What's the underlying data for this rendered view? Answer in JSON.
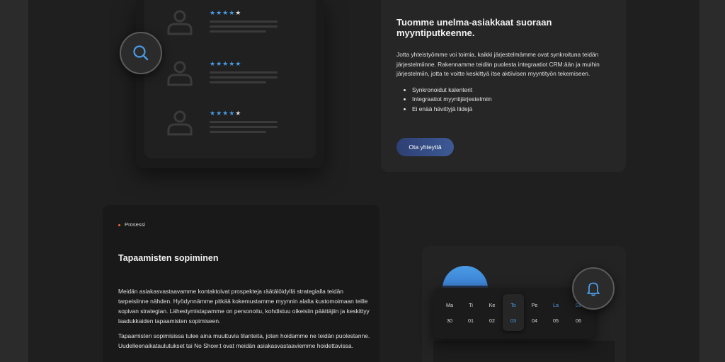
{
  "reviews": {
    "items": [
      {
        "stars_on": "★★★★",
        "stars_off": "★"
      },
      {
        "stars_on": "★★★★★",
        "stars_off": ""
      },
      {
        "stars_on": "★★★★",
        "stars_off": "★"
      }
    ]
  },
  "crm": {
    "title": "Tuomme unelma-asiakkaat suoraan myyntiputkeenne.",
    "body": "Jotta yhteistyömme voi toimia, kaikki järjestelmämme ovat synkroituna teidän järjestelmiinne. Rakennamme teidän puolesta integraatiot CRM:ään ja muihin järjestelmiin, jotta te voitte keskittyä itse aktiivisen myyntityön tekemiseen.",
    "bullets": [
      "Synkronoidut kalenterit",
      "Integraatiot myyntijärjestelmiin",
      "Ei enää hävittyjä liidejä"
    ],
    "button": "Ota yhteyttä"
  },
  "process": {
    "tag": "Prosessi",
    "title": "Tapaamisten sopiminen",
    "p1": "Meidän asiakasvastaavamme kontaktoivat prospekteja räätälöidyllä strategialla teidän tarpeisiinne nähden. Hyödynnämme pitkää kokemustamme myynnin alalta kustomoimaan teille sopivan strategian. Lähestymistapamme on personoitu, kohdistuu oikeisiin päättäjiin ja keskittyy laadukkaiden tapaamisten sopimiseen.",
    "p2": "Tapaamisten sopimisissa tulee aina muuttuvia tilanteita, joten hoidamme ne teidän puolestanne. Uudelleenaikataulutukset tai No Show:t ovat meidän asiakasvastaaviemme hoidettavissa."
  },
  "calendar": {
    "days": [
      "Ma",
      "Ti",
      "Ke",
      "To",
      "Pe",
      "La",
      "Su"
    ],
    "dates": [
      "30",
      "01",
      "02",
      "03",
      "04",
      "05",
      "06"
    ],
    "highlight_color": "#4a9be6"
  },
  "icons": {
    "search": "search-icon",
    "bell": "bell-icon",
    "avatar": "user-icon"
  }
}
